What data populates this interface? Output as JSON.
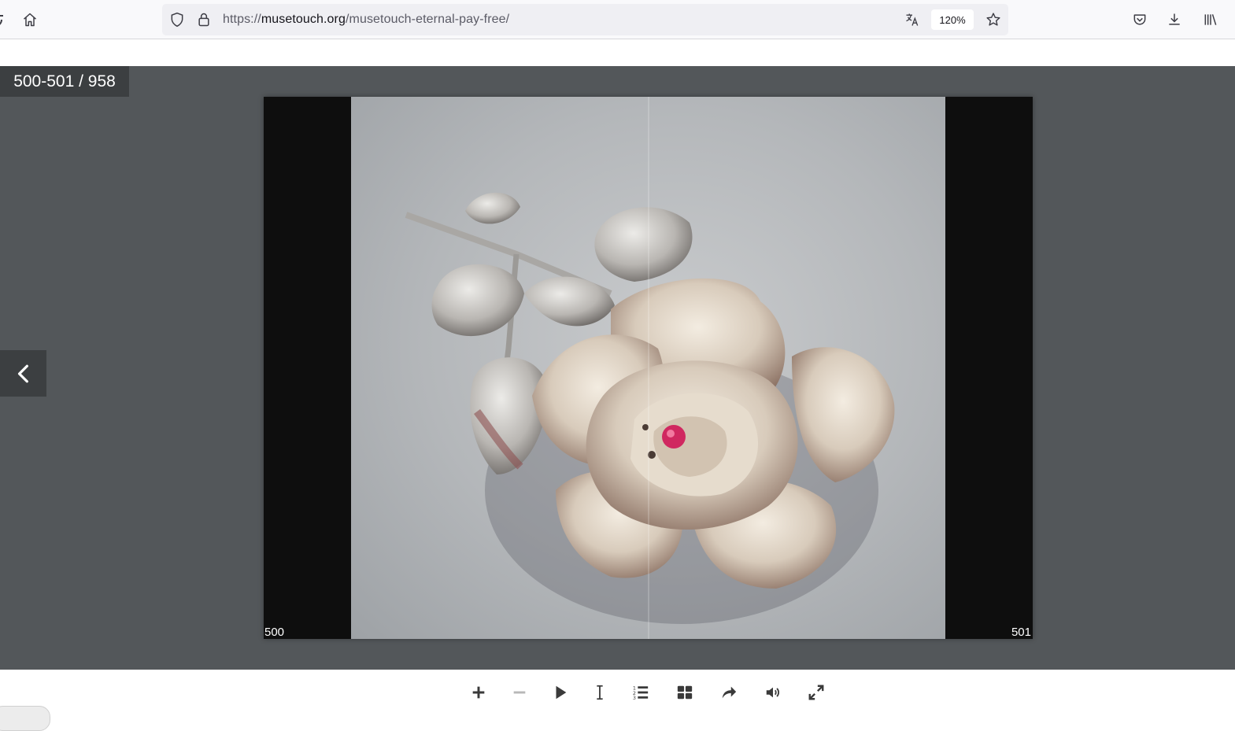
{
  "browser": {
    "url_scheme": "https://",
    "url_host": "musetouch.org",
    "url_path": "/musetouch-eternal-pay-free/",
    "zoom_level": "120%",
    "icons": [
      "reload-icon",
      "home-icon",
      "shield-icon",
      "lock-icon",
      "translate-icon",
      "bookmark-star-icon",
      "pocket-icon",
      "download-icon",
      "library-icon"
    ]
  },
  "viewer": {
    "page_counter": "500-501 / 958",
    "left_page_number": "500",
    "right_page_number": "501",
    "photo_subject": "silver rose brooch with red gem"
  },
  "controls": {
    "icons": [
      "zoom-in-icon",
      "zoom-out-icon",
      "play-icon",
      "text-select-icon",
      "table-of-contents-icon",
      "thumbnails-icon",
      "share-icon",
      "sound-icon",
      "fullscreen-icon"
    ]
  },
  "colors": {
    "viewer_bg": "#53575a",
    "counter_bg": "#3c3f41",
    "control_icon": "#3a3a3a"
  }
}
